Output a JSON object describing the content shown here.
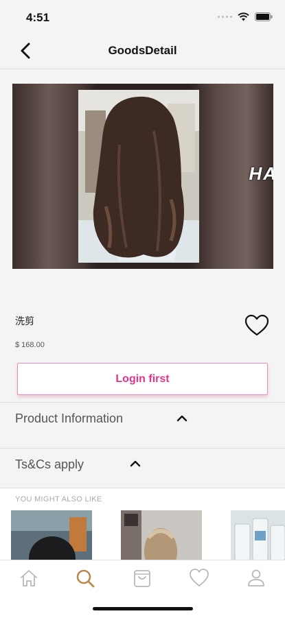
{
  "status": {
    "time": "4:51"
  },
  "nav": {
    "title": "GoodsDetail"
  },
  "product": {
    "image_text": "HA",
    "name": "洗剪",
    "price": "$ 168.00"
  },
  "actions": {
    "login_label": "Login first"
  },
  "sections": [
    {
      "title": "Product Information",
      "expanded": true
    },
    {
      "title": "Ts&Cs apply",
      "expanded": true
    }
  ],
  "recommendations": {
    "label": "YOU MIGHT ALSO LIKE"
  },
  "tabbar": {
    "items": [
      "home-icon",
      "search-icon",
      "bag-icon",
      "heart-icon",
      "profile-icon"
    ],
    "active_color": "#b78a4c",
    "inactive_color": "#b8b8b8"
  },
  "colors": {
    "accent": "#e6338a",
    "accent_border": "#f08ab5"
  }
}
